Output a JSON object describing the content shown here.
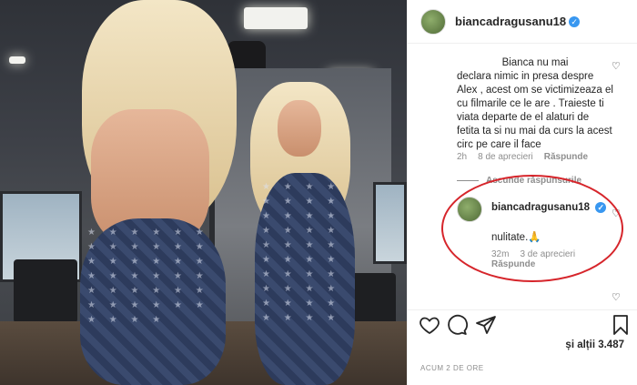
{
  "post": {
    "username": "biancadragusanu18",
    "verified_mark": "✓",
    "likes_text": "și alții 3.487",
    "timestamp": "ACUM 2 DE ORE"
  },
  "comments": [
    {
      "text_line1": "Bianca nu mai",
      "text_rest": "declara nimic in presa despre Alex , acest om se victimizeaza el cu filmarile ce le are . Traieste ti viata departe de el alaturi de fetita ta si nu mai da curs la acest circ pe care il face",
      "time": "2h",
      "likes": "8 de aprecieri",
      "reply_label": "Răspunde"
    }
  ],
  "hide_replies_label": "Ascunde răspunsurile",
  "reply": {
    "username": "biancadragusanu18",
    "text": "nulitate.🙏",
    "time": "32m",
    "likes": "3 de aprecieri",
    "reply_label": "Răspunde"
  },
  "icons": {
    "like": "heart-icon",
    "comment": "comment-icon",
    "share": "share-icon",
    "save": "bookmark-icon"
  },
  "colors": {
    "annotation_circle": "#d6252b",
    "verified": "#3897f0"
  }
}
